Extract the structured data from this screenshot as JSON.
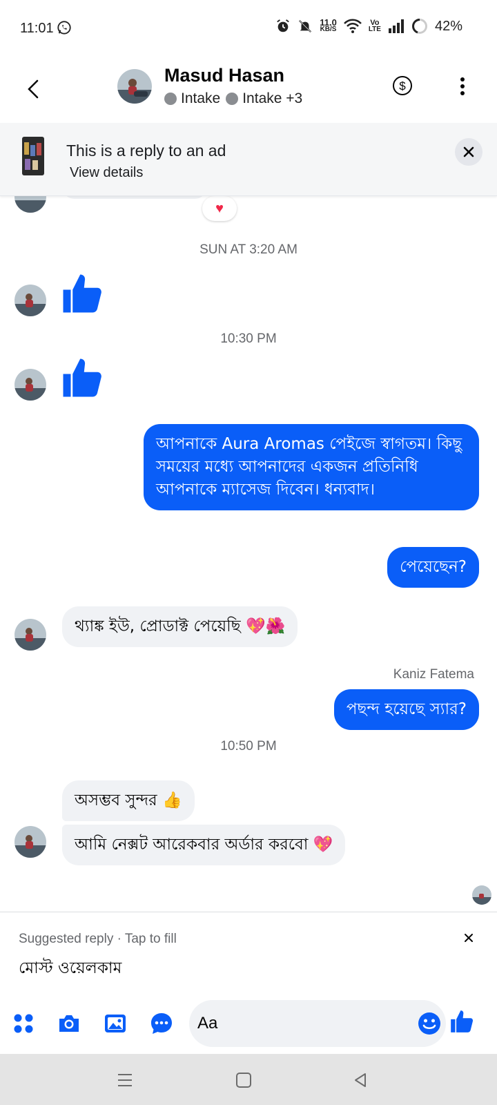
{
  "status_bar": {
    "time": "11:01",
    "net_speed_value": "11.0",
    "net_speed_unit": "KB/S",
    "volte_top": "Vo",
    "volte_bottom": "LTE",
    "battery": "42%"
  },
  "header": {
    "name": "Masud Hasan",
    "label_1": "Intake",
    "label_2": "Intake +3"
  },
  "ad_banner": {
    "title": "This is a reply to an ad",
    "link": "View details"
  },
  "thread": {
    "reaction": "♥",
    "timestamp_1": "SUN AT 3:20 AM",
    "timestamp_2": "10:30 PM",
    "outgoing_1": "আপনাকে Aura Aromas পেইজে স্বাগতম। কিছু সময়ের মধ্যে আপনাদের একজন প্রতিনিধি আপনাকে ম্যাসেজ দিবেন। ধন্যবাদ।",
    "outgoing_2": "পেয়েছেন?",
    "incoming_1": "থ্যাঙ্ক ইউ, প্রোডাক্ট পেয়েছি 💖🌺",
    "sender_name": "Kaniz Fatema",
    "outgoing_3": "পছন্দ হয়েছে স্যার?",
    "timestamp_3": "10:50 PM",
    "incoming_2": "অসম্ভব সুন্দর 👍",
    "incoming_3": "আমি নেক্সট আরেকবার অর্ডার করবো 💖"
  },
  "suggested_reply": {
    "label": "Suggested reply · Tap to fill",
    "text": "মোস্ট ওয়েলকাম"
  },
  "composer": {
    "placeholder": "Aa"
  },
  "colors": {
    "accent": "#0a5ef8",
    "incoming_bubble": "#f0f2f5",
    "ad_banner_bg": "#f5f6f7"
  },
  "icons": [
    "whatsapp-icon",
    "alarm-icon",
    "mute-icon",
    "wifi-icon",
    "signal-icon",
    "battery-icon",
    "back-arrow-icon",
    "dollar-icon",
    "more-vertical-icon",
    "close-icon",
    "like-icon",
    "heart-icon",
    "apps-icon",
    "camera-icon",
    "gallery-icon",
    "chat-bubble-icon",
    "emoji-icon",
    "menu-icon",
    "home-icon",
    "back-icon"
  ]
}
